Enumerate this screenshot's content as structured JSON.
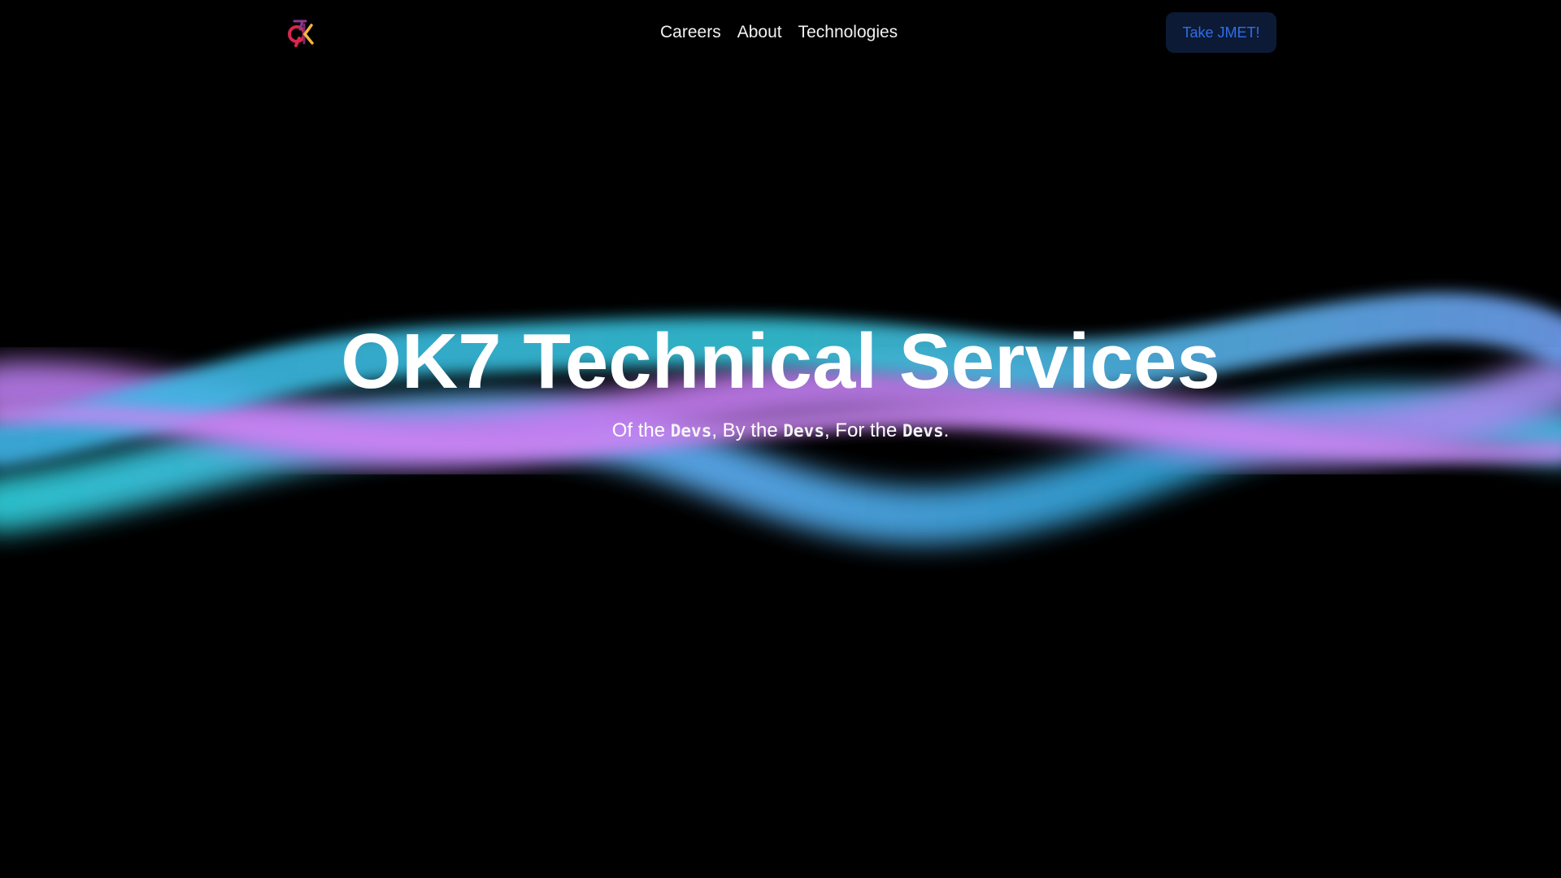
{
  "nav": {
    "logo_icon": "ok7-logo-icon",
    "links": [
      {
        "label": "Careers"
      },
      {
        "label": "About"
      },
      {
        "label": "Technologies"
      }
    ],
    "cta_label": "Take JMET!"
  },
  "hero": {
    "title": "OK7 Technical Services",
    "subtitle": {
      "part1": "Of the ",
      "word1": "Devs",
      "part2": ", By the ",
      "word2": "Devs",
      "part3": ", For the ",
      "word3": "Devs",
      "part4": "."
    },
    "background_icon": "gradient-wave-graphic"
  },
  "colors": {
    "background": "#000000",
    "text": "#ffffff",
    "cta_background": "#0c1a36",
    "cta_text": "#2f6fe8",
    "wave_cyan": "#2ec9d6",
    "wave_blue": "#5aa7ea",
    "wave_purple": "#c67af0",
    "logo_red": "#d8264e",
    "logo_yellow": "#f3b63a"
  }
}
